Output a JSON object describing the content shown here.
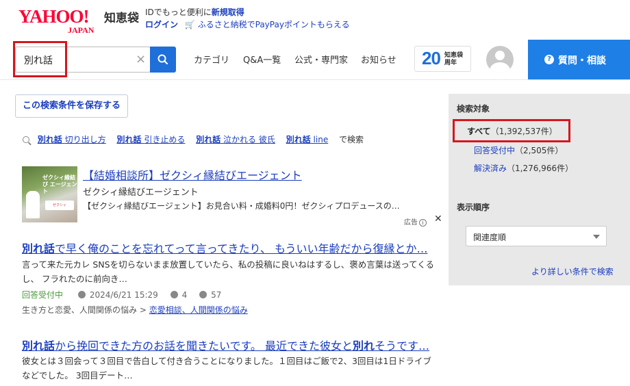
{
  "header": {
    "logo_main": "YAHOO!",
    "logo_sub": "JAPAN",
    "site_name": "知恵袋",
    "promo_line1_prefix": "IDでもっと便利に",
    "promo_line1_link": "新規取得",
    "login_label": "ログイン",
    "promo_line2": "ふるさと納税でPayPayポイントもらえる"
  },
  "search": {
    "query": "別れ話",
    "clear_glyph": "×"
  },
  "nav": {
    "items": [
      "カテゴリ",
      "Q&A一覧",
      "公式・専門家",
      "お知らせ"
    ]
  },
  "anniversary": {
    "number": "20",
    "text_line1": "知恵袋",
    "text_line2": "周年"
  },
  "ask_button": {
    "icon_glyph": "?",
    "label": "質問・相談"
  },
  "save_condition": {
    "label": "この検索条件を保存する"
  },
  "related_searches": {
    "items": [
      {
        "keyword": "別れ話",
        "rest": "切り出し方"
      },
      {
        "keyword": "別れ話",
        "rest": "引き止める"
      },
      {
        "keyword": "別れ話",
        "rest": "泣かれる 彼氏"
      },
      {
        "keyword": "別れ話",
        "rest": "line"
      }
    ],
    "suffix": "で検索"
  },
  "ad": {
    "image_text": "ゼクシィ縁結び エージェント",
    "image_badge": "ゼクシィ",
    "title": "【結婚相談所】ゼクシィ縁結びエージェント",
    "advertiser": "ゼクシィ縁結びエージェント",
    "description": "【ゼクシィ縁結びエージェント】お見合い料・成婚料0円！ゼクシィプロデュースの…",
    "label": "広告",
    "info_glyph": "i",
    "close_glyph": "✕"
  },
  "results": [
    {
      "title_keyword": "別れ話",
      "title_rest": "で早く俺のことを忘れてって言ってきたり、 もういい年齢だから復縁とか…",
      "body": "言って来た元カレ SNSを切らないまま放置していたら、私の投稿に良いねはするし、褒め言葉は送ってくるし、 フラれたのに前向き…",
      "status": "回答受付中",
      "date": "2024/6/21 15:29",
      "answers": "4",
      "views": "57",
      "category_path": "生き方と恋愛、人間関係の悩み",
      "category_sep": ">",
      "category_leaf": "恋愛相談、人間関係の悩み"
    },
    {
      "title_keyword": "別れ話",
      "title_rest_a": "から挽回できた方のお話を聞きたいです。 最近できた彼女と",
      "title_keyword2": "別れ",
      "title_rest_b": "そうです…",
      "body": "彼女とは３回会って３回目で告白して付き合うことになりました。１回目はご飯で2、3回目は1日ドライブなどでした。 3回目デート…"
    }
  ],
  "sidebar": {
    "target_heading": "検索対象",
    "options": [
      {
        "label": "すべて",
        "count": "（1,392,537件）"
      },
      {
        "label": "回答受付中",
        "count": "（2,505件）"
      },
      {
        "label": "解決済み",
        "count": "（1,276,966件）"
      }
    ],
    "order_heading": "表示順序",
    "order_value": "関連度順",
    "advanced_link": "より詳しい条件で検索"
  },
  "colors": {
    "brand_red": "#ff0033",
    "link_blue": "#1a3dbf",
    "accent_blue": "#1e7fe6",
    "highlight_red": "#d6161d",
    "status_green": "#4a9a3a"
  }
}
